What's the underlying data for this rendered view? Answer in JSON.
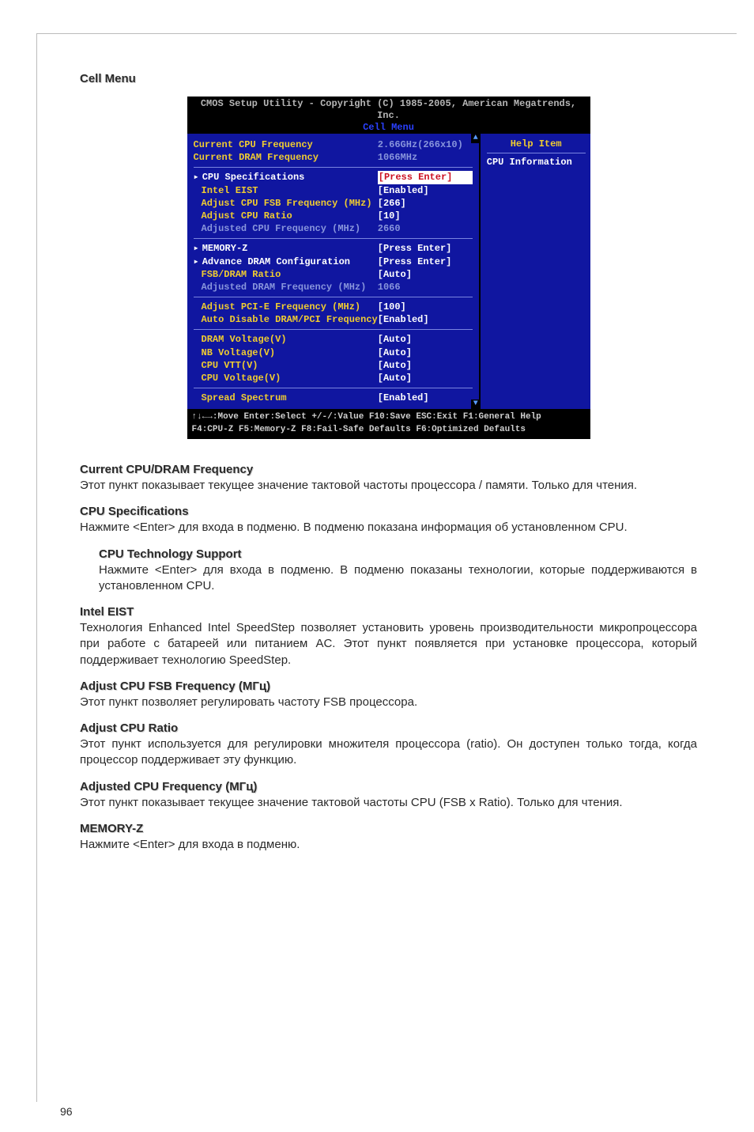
{
  "page_number": "96",
  "section_title": "Cell Menu",
  "bios": {
    "header_line1": "CMOS Setup Utility - Copyright (C) 1985-2005, American Megatrends, Inc.",
    "header_line2": "Cell Menu",
    "help_title": "Help Item",
    "help_text": "CPU Information",
    "scroll_up": "▲",
    "scroll_down": "▼",
    "rows": [
      {
        "lbl": "Current CPU Frequency",
        "val": "2.66GHz(266x10)",
        "lblClass": "yellow",
        "valClass": "grey"
      },
      {
        "lbl": "Current DRAM Frequency",
        "val": "1066MHz",
        "lblClass": "yellow",
        "valClass": "grey"
      }
    ],
    "block2": [
      {
        "lbl": "CPU Specifications",
        "val": "[Press Enter]",
        "lblClass": "white arrow",
        "valClass": "redhl"
      },
      {
        "lbl": "Intel EIST",
        "val": "[Enabled]",
        "lblClass": "yellow noarrow",
        "valClass": "white"
      },
      {
        "lbl": "Adjust CPU FSB Frequency (MHz)",
        "val": "[266]",
        "lblClass": "yellow noarrow",
        "valClass": "white"
      },
      {
        "lbl": "Adjust CPU Ratio",
        "val": "[10]",
        "lblClass": "yellow noarrow",
        "valClass": "white"
      },
      {
        "lbl": "Adjusted CPU Frequency (MHz)",
        "val": "2660",
        "lblClass": "grey noarrow",
        "valClass": "grey"
      }
    ],
    "block3": [
      {
        "lbl": "MEMORY-Z",
        "val": "[Press Enter]",
        "lblClass": "white arrow",
        "valClass": "white"
      },
      {
        "lbl": "Advance DRAM Configuration",
        "val": "[Press Enter]",
        "lblClass": "white arrow",
        "valClass": "white"
      },
      {
        "lbl": "FSB/DRAM Ratio",
        "val": "[Auto]",
        "lblClass": "yellow noarrow",
        "valClass": "white"
      },
      {
        "lbl": "Adjusted DRAM Frequency (MHz)",
        "val": "1066",
        "lblClass": "grey noarrow",
        "valClass": "grey"
      }
    ],
    "block4": [
      {
        "lbl": "Adjust PCI-E Frequency (MHz)",
        "val": "[100]",
        "lblClass": "yellow noarrow",
        "valClass": "white"
      },
      {
        "lbl": "Auto Disable DRAM/PCI Frequency",
        "val": "[Enabled]",
        "lblClass": "yellow noarrow",
        "valClass": "white"
      }
    ],
    "block5": [
      {
        "lbl": "DRAM Voltage(V)",
        "val": "[Auto]",
        "lblClass": "yellow noarrow",
        "valClass": "white"
      },
      {
        "lbl": "NB Voltage(V)",
        "val": "[Auto]",
        "lblClass": "yellow noarrow",
        "valClass": "white"
      },
      {
        "lbl": "CPU VTT(V)",
        "val": "[Auto]",
        "lblClass": "yellow noarrow",
        "valClass": "white"
      },
      {
        "lbl": "CPU Voltage(V)",
        "val": "[Auto]",
        "lblClass": "yellow noarrow",
        "valClass": "white"
      }
    ],
    "block6": [
      {
        "lbl": "Spread Spectrum",
        "val": "[Enabled]",
        "lblClass": "yellow noarrow",
        "valClass": "white"
      }
    ],
    "footer_line1": "↑↓←→:Move   Enter:Select  +/-/:Value  F10:Save  ESC:Exit  F1:General Help",
    "footer_line2": "F4:CPU-Z     F5:Memory-Z    F8:Fail-Safe Defaults     F6:Optimized Defaults"
  },
  "terms": [
    {
      "h": "Current CPU/DRAM Frequency",
      "p": "Этот пункт показывает текущее значение тактовой частоты процессора / памяти. Только для чтения.",
      "indent": false
    },
    {
      "h": "CPU Specifications",
      "p": "Нажмите <Enter> для входа в подменю. В подменю показана информация об установленном CPU.",
      "indent": false
    },
    {
      "h": "CPU Technology Support",
      "p": "Нажмите <Enter> для входа в подменю. В подменю показаны технологии, которые поддерживаются в установленном CPU.",
      "indent": true
    },
    {
      "h": "Intel EIST",
      "p": "Технология Enhanced Intel SpeedStep позволяет установить уровень производительности микропроцессора при работе с батареей или питанием AC. Этот пункт появляется при установке процессора, который поддерживает технологию SpeedStep.",
      "indent": false
    },
    {
      "h": "Adjust CPU FSB Frequency (МГц)",
      "p": "Этот пункт позволяет регулировать частоту FSB процессора.",
      "indent": false
    },
    {
      "h": "Adjust CPU Ratio",
      "p": "Этот пункт используется для регулировки множителя процессора (ratio). Он доступен только тогда, когда процессор поддерживает эту функцию.",
      "indent": false
    },
    {
      "h": "Adjusted CPU Frequency (МГц)",
      "p": "Этот пункт показывает текущее значение тактовой частоты CPU (FSB x Ratio). Только для чтения.",
      "indent": false
    },
    {
      "h": "MEMORY-Z",
      "p": "Нажмите <Enter> для входа в подменю.",
      "indent": false
    }
  ]
}
